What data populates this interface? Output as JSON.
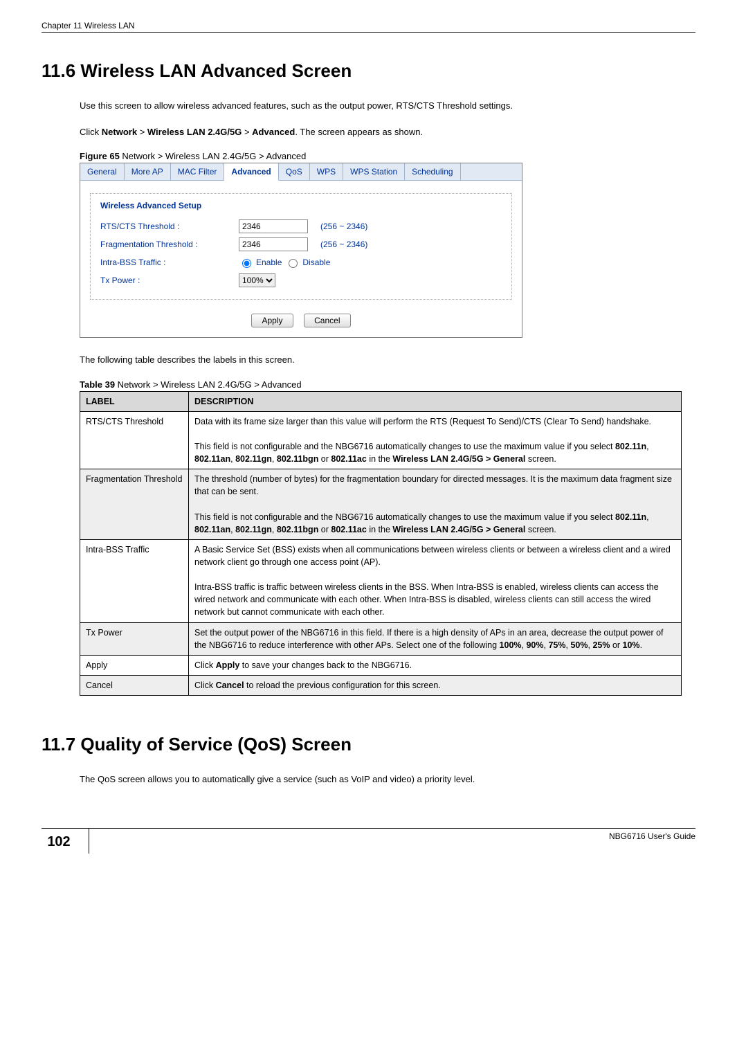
{
  "chapter_header": "Chapter 11 Wireless LAN",
  "section_11_6": {
    "heading": "11.6  Wireless LAN Advanced Screen",
    "para1": "Use this screen to allow wireless advanced features, such as the output power, RTS/CTS Threshold settings.",
    "para2_pre": "Click ",
    "para2_b1": "Network",
    "para2_gt1": " > ",
    "para2_b2": "Wireless LAN 2.4G/5G",
    "para2_gt2": " > ",
    "para2_b3": "Advanced",
    "para2_post": ". The screen appears as shown.",
    "figure_label": "Figure 65",
    "figure_caption": "   Network > Wireless LAN 2.4G/5G > Advanced"
  },
  "figure_ui": {
    "tabs": [
      "General",
      "More AP",
      "MAC Filter",
      "Advanced",
      "QoS",
      "WPS",
      "WPS Station",
      "Scheduling"
    ],
    "active_tab_index": 3,
    "box_title": "Wireless Advanced Setup",
    "rts_label": "RTS/CTS Threshold :",
    "rts_value": "2346",
    "rts_range": "(256 ~ 2346)",
    "frag_label": "Fragmentation Threshold :",
    "frag_value": "2346",
    "frag_range": "(256 ~ 2346)",
    "intra_label": "Intra-BSS Traffic :",
    "enable_label": "Enable",
    "disable_label": "Disable",
    "tx_label": "Tx Power :",
    "tx_value": "100%",
    "apply_btn": "Apply",
    "cancel_btn": "Cancel"
  },
  "table_intro": "The following table describes the labels in this screen.",
  "table_caption_label": "Table 39",
  "table_caption": "   Network > Wireless LAN 2.4G/5G > Advanced",
  "table": {
    "header_label": "LABEL",
    "header_desc": "DESCRIPTION",
    "rows": [
      {
        "label": "RTS/CTS Threshold",
        "desc_parts": [
          {
            "t": "Data with its frame size larger than this value will perform the RTS (Request To Send)/CTS (Clear To Send) handshake."
          },
          {
            "br": true
          },
          {
            "t": "This field is not configurable and the NBG6716 automatically changes to use the maximum value if you select "
          },
          {
            "b": "802.11n"
          },
          {
            "t": ", "
          },
          {
            "b": "802.11an"
          },
          {
            "t": ", "
          },
          {
            "b": "802.11gn"
          },
          {
            "t": ", "
          },
          {
            "b": "802.11bgn"
          },
          {
            "t": " or "
          },
          {
            "b": "802.11ac"
          },
          {
            "t": " in the "
          },
          {
            "b": "Wireless LAN 2.4G/5G > General"
          },
          {
            "t": " screen."
          }
        ]
      },
      {
        "label": "Fragmentation Threshold",
        "desc_parts": [
          {
            "t": "The threshold (number of bytes) for the fragmentation boundary for directed messages. It is the maximum data fragment size that can be sent."
          },
          {
            "br": true
          },
          {
            "t": "This field is not configurable and the NBG6716 automatically changes to use the maximum value if you select "
          },
          {
            "b": "802.11n"
          },
          {
            "t": ", "
          },
          {
            "b": "802.11an"
          },
          {
            "t": ", "
          },
          {
            "b": "802.11gn"
          },
          {
            "t": ", "
          },
          {
            "b": "802.11bgn"
          },
          {
            "t": " or "
          },
          {
            "b": "802.11ac"
          },
          {
            "t": " in the "
          },
          {
            "b": "Wireless LAN 2.4G/5G > General"
          },
          {
            "t": " screen."
          }
        ]
      },
      {
        "label": "Intra-BSS Traffic",
        "desc_parts": [
          {
            "t": "A Basic Service Set (BSS) exists when all communications between wireless clients or between a wireless client and a wired network client go through one access point (AP)."
          },
          {
            "br": true
          },
          {
            "t": "Intra-BSS traffic is traffic between wireless clients in the BSS. When Intra-BSS is enabled, wireless clients can access the wired network and communicate with each other. When Intra-BSS is disabled, wireless clients can still access the wired network but cannot communicate with each other."
          }
        ]
      },
      {
        "label": "Tx Power",
        "desc_parts": [
          {
            "t": "Set the output power of the NBG6716 in this field. If there is a high density of APs in an area, decrease the output power of the NBG6716 to reduce interference with other APs. Select one of the following "
          },
          {
            "b": "100%"
          },
          {
            "t": ", "
          },
          {
            "b": "90%"
          },
          {
            "t": ", "
          },
          {
            "b": "75%"
          },
          {
            "t": ", "
          },
          {
            "b": "50%"
          },
          {
            "t": ", "
          },
          {
            "b": "25%"
          },
          {
            "t": " or "
          },
          {
            "b": "10%"
          },
          {
            "t": "."
          }
        ]
      },
      {
        "label": "Apply",
        "desc_parts": [
          {
            "t": "Click "
          },
          {
            "b": "Apply"
          },
          {
            "t": " to save your changes back to the NBG6716."
          }
        ]
      },
      {
        "label": "Cancel",
        "desc_parts": [
          {
            "t": "Click "
          },
          {
            "b": "Cancel"
          },
          {
            "t": " to reload the previous configuration for this screen."
          }
        ]
      }
    ]
  },
  "section_11_7": {
    "heading": "11.7  Quality of Service (QoS) Screen",
    "para1": "The QoS screen allows you to automatically give a service (such as VoIP and video) a priority level."
  },
  "footer": {
    "page_number": "102",
    "guide": "NBG6716 User's Guide"
  }
}
